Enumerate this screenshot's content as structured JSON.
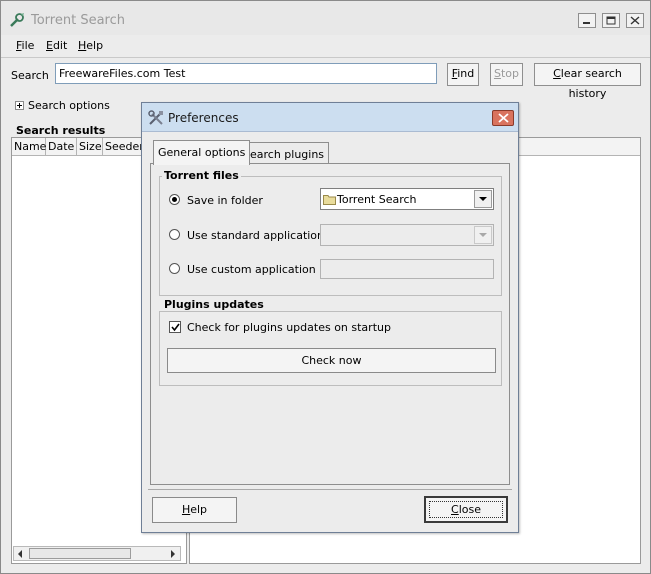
{
  "window": {
    "title": "Torrent Search"
  },
  "menu": {
    "items": [
      {
        "label": "File",
        "accel": "F",
        "rest": "ile"
      },
      {
        "label": "Edit",
        "accel": "E",
        "rest": "dit"
      },
      {
        "label": "Help",
        "accel": "H",
        "rest": "elp"
      }
    ]
  },
  "search": {
    "label": "Search",
    "value": "FreewareFiles.com Test",
    "find_accel": "F",
    "find_rest": "ind",
    "stop_accel": "S",
    "stop_rest": "top",
    "clear_accel": "C",
    "clear_rest": "lear search history",
    "options_label": "Search options"
  },
  "results": {
    "title": "Search results",
    "columns": [
      "Name",
      "Date",
      "Size",
      "Seeders"
    ]
  },
  "preferences": {
    "title": "Preferences",
    "tabs": [
      "General options",
      "Search plugins"
    ],
    "torrent_files": {
      "group_label": "Torrent files",
      "save_in_folder": "Save in folder",
      "folder_value": "Torrent Search",
      "use_standard": "Use standard application",
      "use_custom": "Use custom application"
    },
    "plugins_updates": {
      "group_label": "Plugins updates",
      "check_on_startup": "Check for plugins updates on startup",
      "check_now": "Check now"
    },
    "help_accel": "H",
    "help_rest": "elp",
    "close_accel": "C",
    "close_rest": "lose"
  },
  "colors": {
    "dialog_title_bg": "#ccdef0",
    "close_red": "#d9735e",
    "input_border": "#7f9db9"
  },
  "icons": [
    "torrent-search-app-icon",
    "minimize-icon",
    "maximize-icon",
    "close-icon",
    "expand-plus-icon",
    "preferences-tools-icon",
    "folder-icon",
    "dropdown-arrow-icon",
    "checkmark-icon",
    "scroll-left-icon",
    "scroll-right-icon"
  ]
}
